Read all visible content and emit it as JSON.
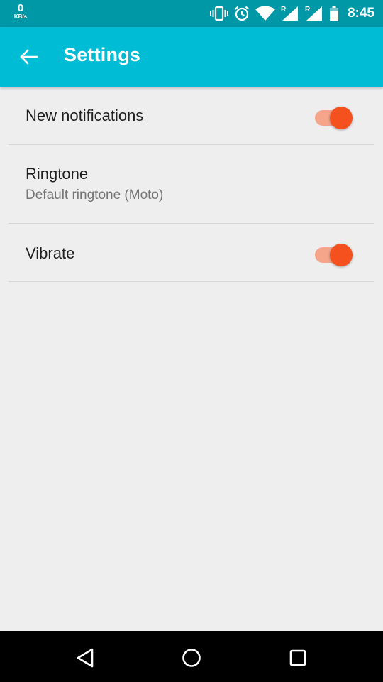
{
  "status_bar": {
    "net_speed_value": "0",
    "net_speed_unit": "KB/s",
    "roaming_label_1": "R",
    "roaming_label_2": "R",
    "time": "8:45",
    "icons": [
      "vibrate-icon",
      "alarm-icon",
      "wifi-icon",
      "signal-roaming-icon",
      "signal-roaming-icon",
      "battery-icon"
    ]
  },
  "app_bar": {
    "title": "Settings",
    "back_icon": "arrow-back-icon"
  },
  "settings": {
    "items": [
      {
        "title": "New notifications",
        "type": "switch",
        "checked": true
      },
      {
        "title": "Ringtone",
        "subtitle": "Default ringtone (Moto)",
        "type": "link"
      },
      {
        "title": "Vibrate",
        "type": "switch",
        "checked": true
      }
    ]
  },
  "nav_bar": {
    "buttons": [
      "nav-back-icon",
      "nav-home-icon",
      "nav-recents-icon"
    ]
  },
  "colors": {
    "status_bar": "#0097a7",
    "app_bar": "#00bcd4",
    "background": "#eeeeee",
    "switch_thumb": "#f4511e",
    "switch_track": "#f5a58a",
    "nav_bar": "#000000"
  }
}
